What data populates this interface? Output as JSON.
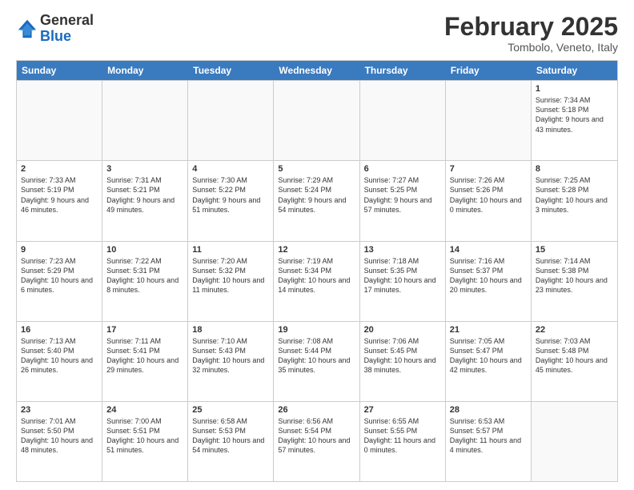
{
  "header": {
    "logo_general": "General",
    "logo_blue": "Blue",
    "month_title": "February 2025",
    "location": "Tombolo, Veneto, Italy"
  },
  "weekdays": [
    "Sunday",
    "Monday",
    "Tuesday",
    "Wednesday",
    "Thursday",
    "Friday",
    "Saturday"
  ],
  "weeks": [
    [
      {
        "day": "",
        "info": ""
      },
      {
        "day": "",
        "info": ""
      },
      {
        "day": "",
        "info": ""
      },
      {
        "day": "",
        "info": ""
      },
      {
        "day": "",
        "info": ""
      },
      {
        "day": "",
        "info": ""
      },
      {
        "day": "1",
        "info": "Sunrise: 7:34 AM\nSunset: 5:18 PM\nDaylight: 9 hours and 43 minutes."
      }
    ],
    [
      {
        "day": "2",
        "info": "Sunrise: 7:33 AM\nSunset: 5:19 PM\nDaylight: 9 hours and 46 minutes."
      },
      {
        "day": "3",
        "info": "Sunrise: 7:31 AM\nSunset: 5:21 PM\nDaylight: 9 hours and 49 minutes."
      },
      {
        "day": "4",
        "info": "Sunrise: 7:30 AM\nSunset: 5:22 PM\nDaylight: 9 hours and 51 minutes."
      },
      {
        "day": "5",
        "info": "Sunrise: 7:29 AM\nSunset: 5:24 PM\nDaylight: 9 hours and 54 minutes."
      },
      {
        "day": "6",
        "info": "Sunrise: 7:27 AM\nSunset: 5:25 PM\nDaylight: 9 hours and 57 minutes."
      },
      {
        "day": "7",
        "info": "Sunrise: 7:26 AM\nSunset: 5:26 PM\nDaylight: 10 hours and 0 minutes."
      },
      {
        "day": "8",
        "info": "Sunrise: 7:25 AM\nSunset: 5:28 PM\nDaylight: 10 hours and 3 minutes."
      }
    ],
    [
      {
        "day": "9",
        "info": "Sunrise: 7:23 AM\nSunset: 5:29 PM\nDaylight: 10 hours and 6 minutes."
      },
      {
        "day": "10",
        "info": "Sunrise: 7:22 AM\nSunset: 5:31 PM\nDaylight: 10 hours and 8 minutes."
      },
      {
        "day": "11",
        "info": "Sunrise: 7:20 AM\nSunset: 5:32 PM\nDaylight: 10 hours and 11 minutes."
      },
      {
        "day": "12",
        "info": "Sunrise: 7:19 AM\nSunset: 5:34 PM\nDaylight: 10 hours and 14 minutes."
      },
      {
        "day": "13",
        "info": "Sunrise: 7:18 AM\nSunset: 5:35 PM\nDaylight: 10 hours and 17 minutes."
      },
      {
        "day": "14",
        "info": "Sunrise: 7:16 AM\nSunset: 5:37 PM\nDaylight: 10 hours and 20 minutes."
      },
      {
        "day": "15",
        "info": "Sunrise: 7:14 AM\nSunset: 5:38 PM\nDaylight: 10 hours and 23 minutes."
      }
    ],
    [
      {
        "day": "16",
        "info": "Sunrise: 7:13 AM\nSunset: 5:40 PM\nDaylight: 10 hours and 26 minutes."
      },
      {
        "day": "17",
        "info": "Sunrise: 7:11 AM\nSunset: 5:41 PM\nDaylight: 10 hours and 29 minutes."
      },
      {
        "day": "18",
        "info": "Sunrise: 7:10 AM\nSunset: 5:43 PM\nDaylight: 10 hours and 32 minutes."
      },
      {
        "day": "19",
        "info": "Sunrise: 7:08 AM\nSunset: 5:44 PM\nDaylight: 10 hours and 35 minutes."
      },
      {
        "day": "20",
        "info": "Sunrise: 7:06 AM\nSunset: 5:45 PM\nDaylight: 10 hours and 38 minutes."
      },
      {
        "day": "21",
        "info": "Sunrise: 7:05 AM\nSunset: 5:47 PM\nDaylight: 10 hours and 42 minutes."
      },
      {
        "day": "22",
        "info": "Sunrise: 7:03 AM\nSunset: 5:48 PM\nDaylight: 10 hours and 45 minutes."
      }
    ],
    [
      {
        "day": "23",
        "info": "Sunrise: 7:01 AM\nSunset: 5:50 PM\nDaylight: 10 hours and 48 minutes."
      },
      {
        "day": "24",
        "info": "Sunrise: 7:00 AM\nSunset: 5:51 PM\nDaylight: 10 hours and 51 minutes."
      },
      {
        "day": "25",
        "info": "Sunrise: 6:58 AM\nSunset: 5:53 PM\nDaylight: 10 hours and 54 minutes."
      },
      {
        "day": "26",
        "info": "Sunrise: 6:56 AM\nSunset: 5:54 PM\nDaylight: 10 hours and 57 minutes."
      },
      {
        "day": "27",
        "info": "Sunrise: 6:55 AM\nSunset: 5:55 PM\nDaylight: 11 hours and 0 minutes."
      },
      {
        "day": "28",
        "info": "Sunrise: 6:53 AM\nSunset: 5:57 PM\nDaylight: 11 hours and 4 minutes."
      },
      {
        "day": "",
        "info": ""
      }
    ]
  ]
}
